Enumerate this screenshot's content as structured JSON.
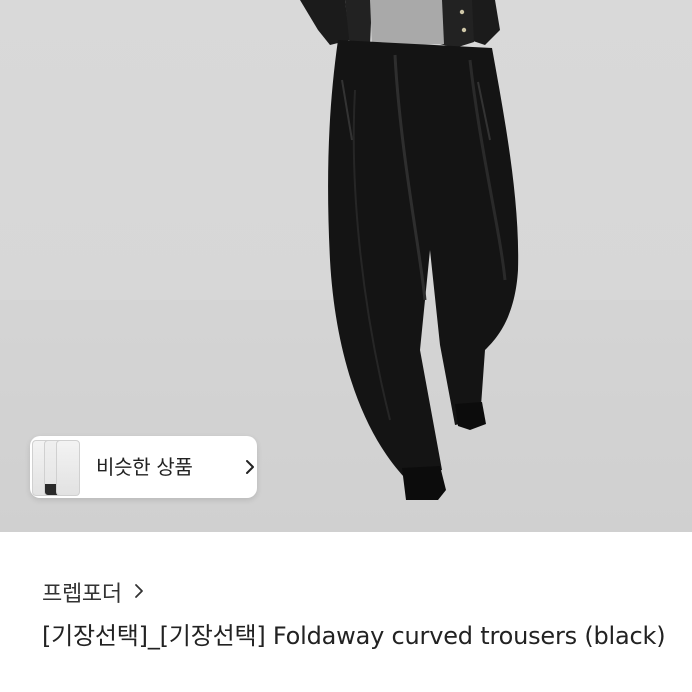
{
  "product_image": {
    "alt": "",
    "similar_button": {
      "label": "비슷한 상품",
      "icon": "chevron-right-icon",
      "thumbnail_count": 3
    }
  },
  "shop": {
    "name": "프렙포더",
    "icon": "chevron-right-icon"
  },
  "product": {
    "title": "[기장선택]_[기장선택] Foldaway curved trousers (black)"
  },
  "colors": {
    "background": "#ffffff",
    "image_backdrop": "#d8d8d8",
    "text_primary": "#222222",
    "chip_background": "#ffffff"
  }
}
